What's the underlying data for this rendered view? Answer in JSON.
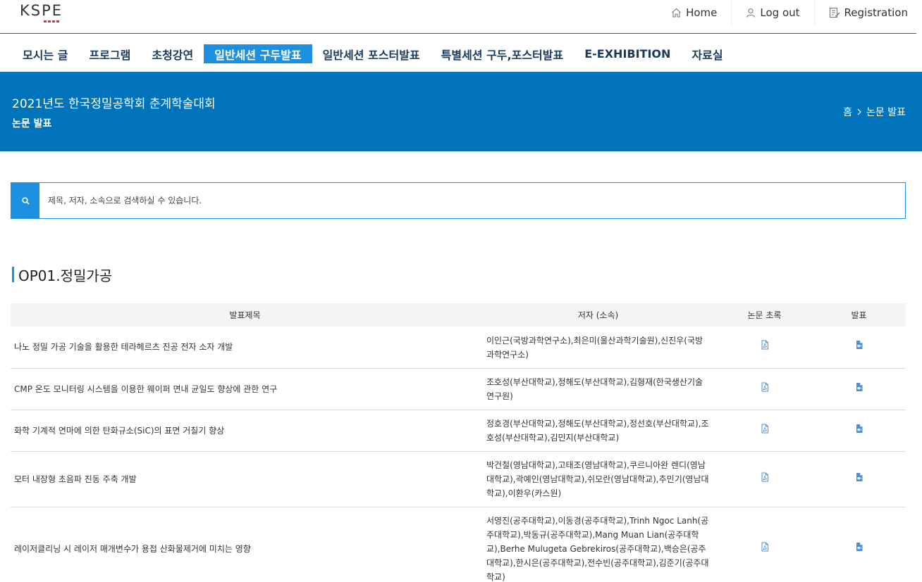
{
  "header": {
    "logo_text": "KSPE",
    "links": [
      {
        "label": "Home",
        "icon": "home-icon"
      },
      {
        "label": "Log out",
        "icon": "user-icon"
      },
      {
        "label": "Registration",
        "icon": "registration-icon"
      }
    ]
  },
  "nav": {
    "items": [
      {
        "label": "모시는 글",
        "active": false
      },
      {
        "label": "프로그램",
        "active": false
      },
      {
        "label": "초청강연",
        "active": false
      },
      {
        "label": "일반세션 구두발표",
        "active": true
      },
      {
        "label": "일반세션 포스터발표",
        "active": false
      },
      {
        "label": "특별세션 구두,포스터발표",
        "active": false
      },
      {
        "label": "E-EXHIBITION",
        "active": false
      },
      {
        "label": "자료실",
        "active": false
      }
    ]
  },
  "banner": {
    "title": "2021년도 한국정밀공학회 춘계학술대회",
    "subtitle": "논문 발표",
    "breadcrumb": [
      "홈",
      "논문 발표"
    ]
  },
  "search": {
    "placeholder": "제목, 저자, 소속으로 검색하실 수 있습니다.",
    "value": ""
  },
  "section": {
    "title": "OP01.정밀가공"
  },
  "table": {
    "headers": [
      "발표제목",
      "저자 (소속)",
      "논문 초록",
      "발표"
    ],
    "rows": [
      {
        "title": "나노 정밀 가공 기술을 활용한 테라헤르츠 진공 전자 소자 개발",
        "authors": "이인근(국방과학연구소),최은미(울산과학기술원),신진우(국방과학연구소)"
      },
      {
        "title": "CMP 온도 모니터링 시스템을 이용한 웨이퍼 면내 균일도 향상에 관한 연구",
        "authors": "조호성(부산대학교),정해도(부산대학교),김형재(한국생산기술연구원)"
      },
      {
        "title": "화학 기계적 연마에 의한 탄화규소(SiC)의 표면 거칠기 향상",
        "authors": "정호경(부산대학교),정해도(부산대학교),정선호(부산대학교),조호성(부산대학교),김민지(부산대학교)"
      },
      {
        "title": "모터 내장형 초음파 진동 주축 개발",
        "authors": "박건철(영남대학교),고태조(영남대학교),쿠르니아완 렌디(영남대학교),곽예인(영남대학교),쉬모란(영남대학교),추민기(영남대학교),이환우(카스원)"
      },
      {
        "title": "레이저클리닝 시 레이저 매개변수가 용접 산화물제거에 미치는 영향",
        "authors": "서영진(공주대학교),이동경(공주대학교),Trinh Ngoc Lanh(공주대학교),박동규(공주대학교),Mang Muan Lian(공주대학교),Berhe Mulugeta Gebrekiros(공주대학교),백승은(공주대학교),한시은(공주대학교),전수빈(공주대학교),김준기(공주대학교)"
      }
    ]
  },
  "colors": {
    "accent": "#1e90e0",
    "banner": "#0073ba",
    "nav_text": "#1a3a5c"
  }
}
